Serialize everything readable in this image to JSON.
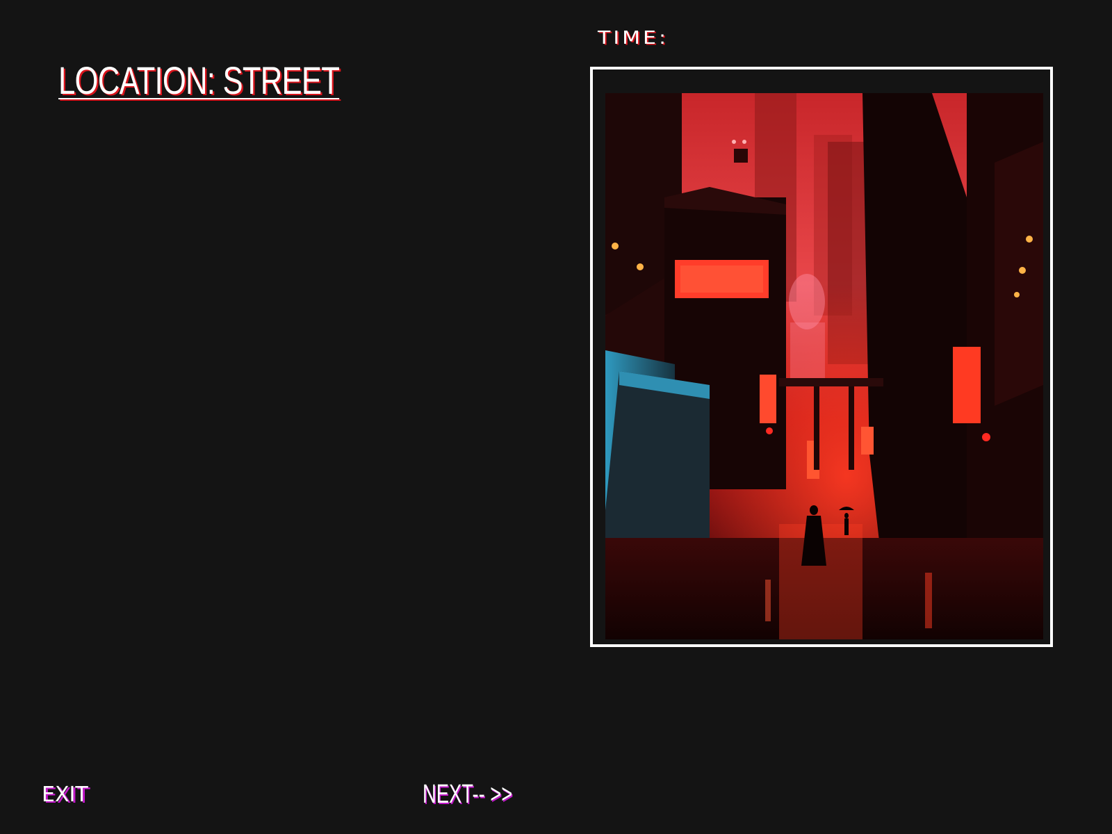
{
  "location": {
    "title": "LOCATION: STREET"
  },
  "time": {
    "label": "TIME:"
  },
  "scene": {
    "description_icon": "cyberpunk-street-image",
    "colors": {
      "sky": "#e53a3a",
      "glow": "#ff2a1a",
      "building_dark": "#1c0707",
      "accent_cyan": "#2e8fb3"
    }
  },
  "controls": {
    "exit_label": "EXIT",
    "next_label": "NEXT-- >>"
  },
  "theme": {
    "background": "#141414",
    "title_shadow": "#d9141c",
    "button_shadow": "#c018c8"
  }
}
